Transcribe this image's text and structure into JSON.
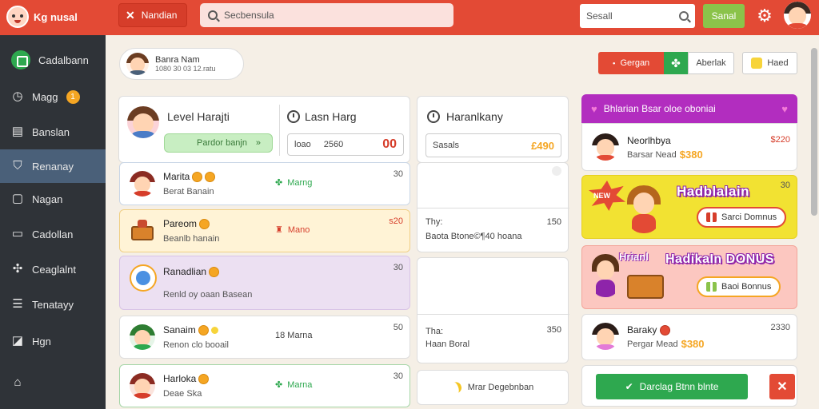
{
  "header": {
    "logo_text": "Kg nusal",
    "close_button_label": "Nandian",
    "search_placeholder": "Secbensula",
    "right_search_placeholder": "Sesall",
    "green_button_label": "Sanal"
  },
  "sidebar": {
    "items": [
      {
        "label": "Cadalbann",
        "icon": "grid-icon"
      },
      {
        "label": "Magg",
        "icon": "clock-icon",
        "badge": "1"
      },
      {
        "label": "Banslan",
        "icon": "list-icon"
      },
      {
        "label": "Renanay",
        "icon": "shield-icon",
        "active": true
      },
      {
        "label": "Nagan",
        "icon": "document-icon"
      },
      {
        "label": "Cadollan",
        "icon": "monitor-icon"
      },
      {
        "label": "Ceaglalnt",
        "icon": "puzzle-icon"
      },
      {
        "label": "Tenatayy",
        "icon": "list-icon"
      },
      {
        "label": "Hgn",
        "icon": "chart-icon"
      },
      {
        "label": "",
        "icon": "home-icon"
      }
    ]
  },
  "user_card": {
    "name": "Banra Nam",
    "sub": "1080 30 03 12.ratu"
  },
  "actions": {
    "red_button": "Gergan",
    "white_button": "Aberlak",
    "hand_button": "Haed"
  },
  "level": {
    "title": "Level Harajti",
    "pill_text": "Pardor banjn",
    "pill_arrow": "»"
  },
  "last_hang": {
    "title": "Lasn Harg",
    "box_a": "loao",
    "box_b": "2560",
    "box_big": "00"
  },
  "rows": [
    {
      "name": "Marita",
      "sub": "Berat Banain",
      "mid": "Marng",
      "num": "30",
      "bg": "#ffffff",
      "border": "#c9d6e6"
    },
    {
      "name": "Pareom",
      "sub": "Beanlb hanain",
      "mid": "Mano",
      "num": "s20",
      "bg": "#fff3d6",
      "border": "#f0cf84"
    },
    {
      "name": "Ranadlian",
      "sub": "Renld oy oaan Basean",
      "mid": "",
      "num": "30",
      "bg": "#ece0f2",
      "border": "#d8c3e6"
    },
    {
      "name": "Sanaim",
      "sub": "Renon clo booail",
      "mid": "18 Marna",
      "num": "50",
      "bg": "#ffffff",
      "border": "#ddd"
    },
    {
      "name": "Harloka",
      "sub": "Deae Ska",
      "mid": "Marna",
      "num": "30",
      "bg": "#ffffff",
      "border": "#a5d6a7"
    }
  ],
  "harankany": {
    "title": "Haranlkany",
    "box_text": "Sasals",
    "box_big": "£490",
    "card1_label": "Thy:",
    "card1_sub": "Baota Btone©¶40 hoana",
    "card1_num": "150",
    "card2_label": "Tha:",
    "card2_sub": "Haan Boral",
    "card2_num": "350",
    "bottom_text": "Mrar Degebnban"
  },
  "bonus": {
    "header": "Bhlarian Bsar oloe oboniai",
    "card1_name": "Neorlhbya",
    "card1_sub": "Barsar Nead",
    "card1_amount": "$380",
    "card1_num": "$220",
    "promo1_title": "Hadblalain",
    "promo1_badge_text": "NEW",
    "promo1_button": "Sarci Domnus",
    "promo1_num": "30",
    "promo2_title": "HadikaIn DONUS",
    "promo2_tag": "Hrianl",
    "promo2_button": "Baoi Bonnus",
    "card2_name": "Baraky",
    "card2_sub": "Pergar Mead",
    "card2_amount": "$380",
    "card2_num": "2330",
    "action_button": "Darclag Btnn blnte"
  },
  "colors": {
    "topbar": "#e34a35",
    "sidebar": "#2f3338",
    "sidebar_active": "#4a6079",
    "accent_green": "#2ea84f",
    "bonus_header": "#b22dbf"
  }
}
